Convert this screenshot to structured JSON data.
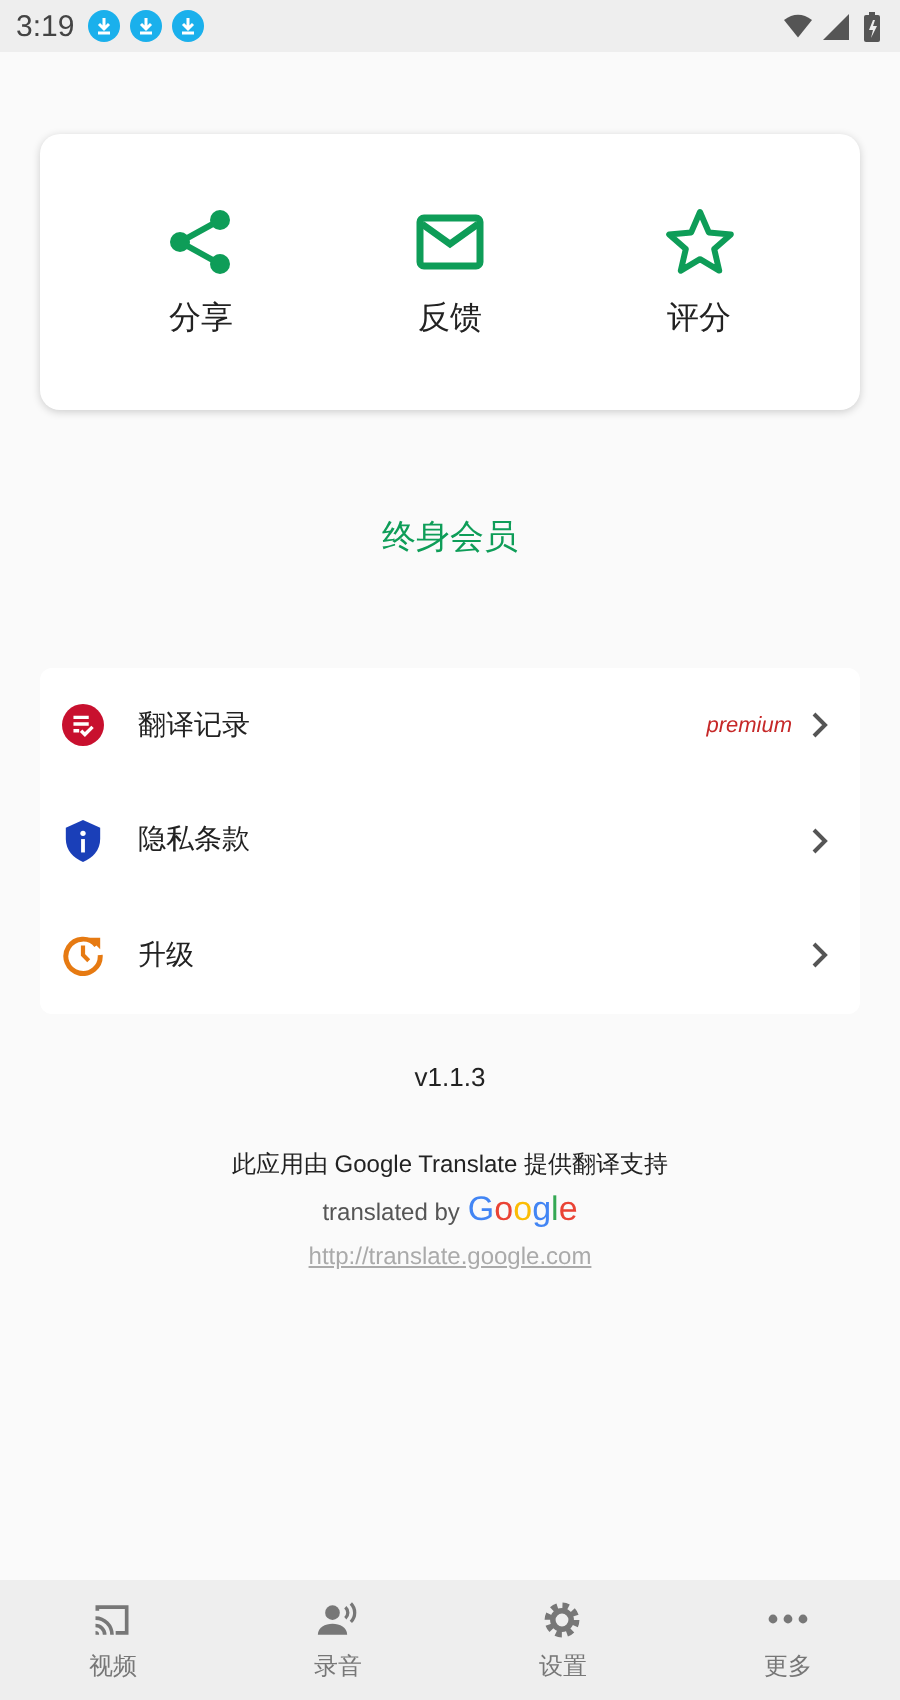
{
  "status_bar": {
    "time": "3:19",
    "notifications": [
      {
        "kind": "download"
      },
      {
        "kind": "download"
      },
      {
        "kind": "download"
      }
    ]
  },
  "actions": [
    {
      "kind": "share",
      "label": "分享"
    },
    {
      "kind": "mail",
      "label": "反馈"
    },
    {
      "kind": "star",
      "label": "评分"
    }
  ],
  "membership": "终身会员",
  "menu": [
    {
      "kind": "history",
      "label": "翻译记录",
      "badge": "premium"
    },
    {
      "kind": "privacy",
      "label": "隐私条款"
    },
    {
      "kind": "upgrade",
      "label": "升级"
    }
  ],
  "version": "v1.1.3",
  "credits": {
    "text": "此应用由 Google Translate 提供翻译支持",
    "translated_by": "translated by",
    "logo": "Google",
    "link": "http://translate.google.com"
  },
  "bottom_nav": [
    {
      "kind": "cast",
      "label": "视频",
      "selected": false
    },
    {
      "kind": "voice",
      "label": "录音",
      "selected": false
    },
    {
      "kind": "gear",
      "label": "设置",
      "selected": false
    },
    {
      "kind": "more",
      "label": "更多",
      "selected": false
    }
  ]
}
